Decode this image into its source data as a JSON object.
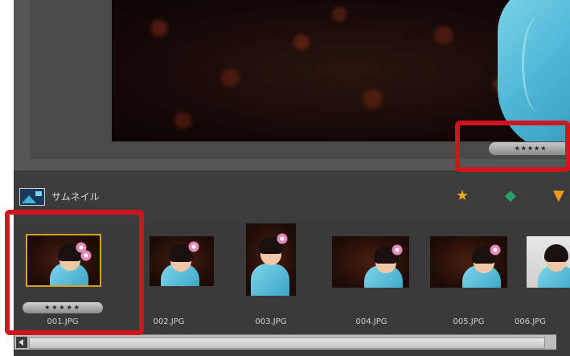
{
  "preview": {
    "rating": "★★★★★"
  },
  "panel": {
    "title": "サムネイル",
    "icon": "thumbnail-panel-icon",
    "filters": [
      {
        "name": "star-filter-icon",
        "glyph": "★",
        "color": "#f0a820"
      },
      {
        "name": "tag-filter-icon",
        "glyph": "◆",
        "color": "#29a06a"
      },
      {
        "name": "funnel-filter-icon",
        "glyph": "▼",
        "color": "#f09a20"
      }
    ]
  },
  "thumbnails": [
    {
      "filename": "001.JPG",
      "rating": "★★★★★",
      "selected": true
    },
    {
      "filename": "002.JPG"
    },
    {
      "filename": "003.JPG"
    },
    {
      "filename": "004.JPG"
    },
    {
      "filename": "005.JPG"
    },
    {
      "filename": "006.JPG"
    }
  ],
  "colors": {
    "highlight": "#d1141f",
    "selection": "#d8a020",
    "panel_bg": "#3a3a3a"
  }
}
